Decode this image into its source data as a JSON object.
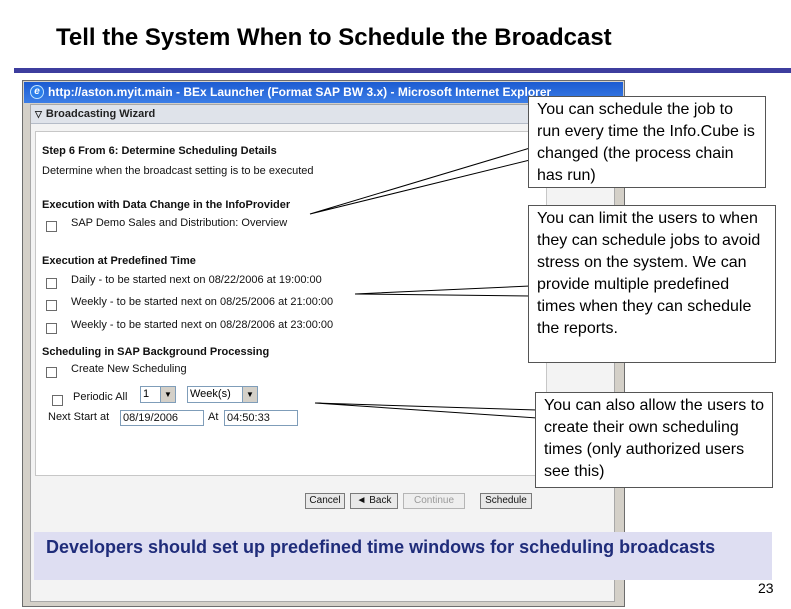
{
  "slide": {
    "title": "Tell the System When to Schedule the Broadcast",
    "page_number": "23",
    "banner": "Developers should set up predefined time windows for scheduling broadcasts"
  },
  "window": {
    "title": "http://aston.myit.main - BEx Launcher (Format SAP BW 3.x) - Microsoft Internet Explorer"
  },
  "wizard": {
    "header": "Broadcasting Wizard",
    "step_title": "Step 6 From 6: Determine Scheduling Details",
    "step_desc": "Determine when the broadcast setting is to be executed",
    "sections": {
      "data_change": {
        "heading": "Execution with Data Change in the InfoProvider",
        "option": "SAP Demo Sales and Distribution: Overview"
      },
      "predefined": {
        "heading": "Execution at Predefined Time",
        "options": [
          "Daily - to be started next on 08/22/2006 at 19:00:00",
          "Weekly - to be started next on 08/25/2006 at 21:00:00",
          "Weekly - to be started next on 08/28/2006 at 23:00:00"
        ]
      },
      "background": {
        "heading": "Scheduling in SAP Background Processing",
        "create_new": "Create New Scheduling",
        "periodic_all": "Periodic All",
        "period_count": "1",
        "period_unit": "Week(s)",
        "next_start_label": "Next Start at",
        "next_start_date": "08/19/2006",
        "at_label": "At",
        "next_start_time": "04:50:33"
      }
    },
    "buttons": {
      "cancel": "Cancel",
      "back": "Back",
      "continue": "Continue",
      "schedule": "Schedule"
    }
  },
  "callouts": [
    "You can schedule the job to run every time the Info.Cube is changed (the process chain has run)",
    "You can limit the users to when they can schedule jobs to avoid stress on the system. We can provide multiple predefined times when they can schedule the reports.",
    "You can also allow the users to create their own scheduling times (only authorized users see this)"
  ],
  "colors": {
    "title_rule": "#3d3d9e",
    "banner_bg": "#dedef2",
    "banner_text": "#1f2c7a",
    "ie_titlebar": "#1c5bd1"
  }
}
